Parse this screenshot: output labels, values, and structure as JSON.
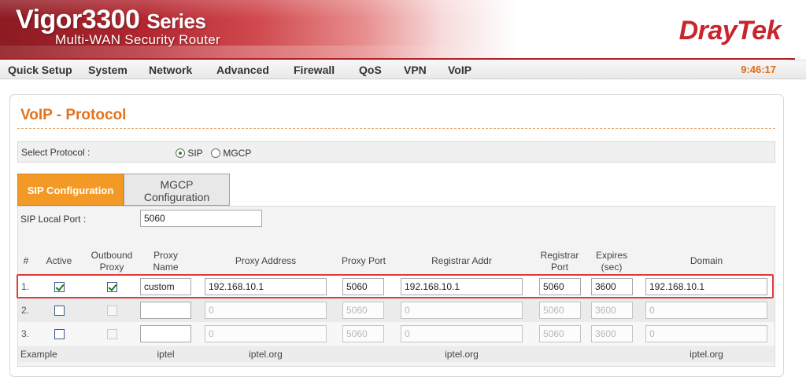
{
  "header": {
    "product_name": "Vigor3300",
    "product_series": "Series",
    "subtitle": "Multi-WAN Security Router",
    "brand": "DrayTek"
  },
  "menu": {
    "items": [
      "Quick Setup",
      "System",
      "Network",
      "Advanced",
      "Firewall",
      "QoS",
      "VPN",
      "VoIP"
    ],
    "clock": "9:46:17"
  },
  "page": {
    "title": "VoIP - Protocol",
    "select_protocol_label": "Select Protocol :",
    "protocols": [
      {
        "label": "SIP",
        "checked": true
      },
      {
        "label": "MGCP",
        "checked": false
      }
    ]
  },
  "tabs": {
    "active": "SIP Configuration",
    "inactive_line1": "MGCP",
    "inactive_line2": "Configuration"
  },
  "sip": {
    "local_port_label": "SIP Local Port :",
    "local_port_value": "5060"
  },
  "table": {
    "headers": {
      "num": "#",
      "active": "Active",
      "outbound_proxy_1": "Outbound",
      "outbound_proxy_2": "Proxy",
      "proxy_name_1": "Proxy",
      "proxy_name_2": "Name",
      "proxy_address": "Proxy Address",
      "proxy_port": "Proxy Port",
      "registrar_addr": "Registrar Addr",
      "registrar_port_1": "Registrar",
      "registrar_port_2": "Port",
      "expires_1": "Expires",
      "expires_2": "(sec)",
      "domain": "Domain"
    },
    "rows": [
      {
        "num": "1.",
        "active": true,
        "outbound_proxy": true,
        "proxy_name": "custom",
        "proxy_address": "192.168.10.1",
        "proxy_port": "5060",
        "registrar_addr": "192.168.10.1",
        "registrar_port": "5060",
        "expires": "3600",
        "domain": "192.168.10.1"
      },
      {
        "num": "2.",
        "active": false,
        "outbound_proxy": false,
        "proxy_name": "",
        "proxy_address": "0",
        "proxy_port": "5060",
        "registrar_addr": "0",
        "registrar_port": "5060",
        "expires": "3600",
        "domain": "0"
      },
      {
        "num": "3.",
        "active": false,
        "outbound_proxy": false,
        "proxy_name": "",
        "proxy_address": "0",
        "proxy_port": "5060",
        "registrar_addr": "0",
        "registrar_port": "5060",
        "expires": "3600",
        "domain": "0"
      }
    ],
    "example": {
      "label": "Example",
      "proxy_name": "iptel",
      "proxy_address": "iptel.org",
      "registrar_addr": "iptel.org",
      "domain": "iptel.org"
    }
  },
  "colors": {
    "accent_orange": "#e3731c",
    "tab_active": "#f39a26",
    "brand_red": "#c8252c",
    "highlight_red": "#e03a3a"
  }
}
